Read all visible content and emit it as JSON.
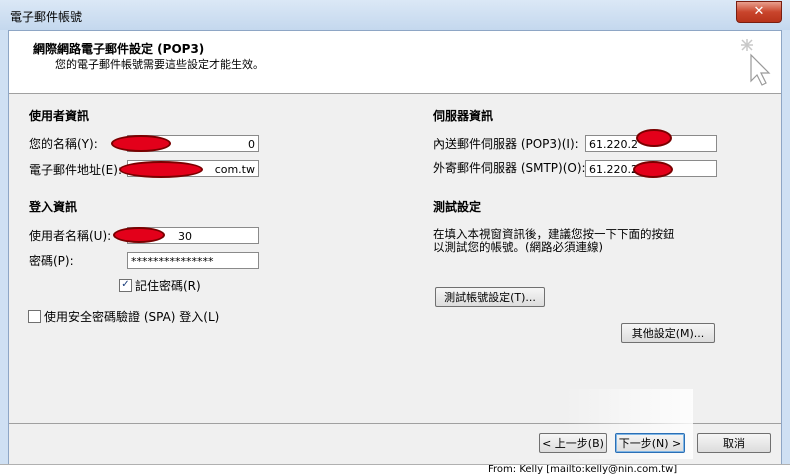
{
  "window": {
    "title": "電子郵件帳號",
    "close_label": "✕"
  },
  "header": {
    "title": "網際網路電子郵件設定 (POP3)",
    "subtitle": "您的電子郵件帳號需要這些設定才能生效。"
  },
  "user_info": {
    "section": "使用者資訊",
    "name_label": "您的名稱(Y):",
    "name_value": "0",
    "email_label": "電子郵件地址(E):",
    "email_value": "com.tw"
  },
  "server_info": {
    "section": "伺服器資訊",
    "incoming_label": "內送郵件伺服器 (POP3)(I):",
    "incoming_value": "61.220.2",
    "outgoing_label": "外寄郵件伺服器 (SMTP)(O):",
    "outgoing_value": "61.220.2"
  },
  "login_info": {
    "section": "登入資訊",
    "username_label": "使用者名稱(U):",
    "username_value": "30",
    "password_label": "密碼(P):",
    "password_value": "***************",
    "remember_label": "記住密碼(R)",
    "remember_checked": "✓",
    "spa_label": "使用安全密碼驗證 (SPA) 登入(L)"
  },
  "test_settings": {
    "section": "測試設定",
    "description_line1": "在填入本視窗資訊後，建議您按一下下面的按鈕",
    "description_line2": "以測試您的帳號。(網路必須連線)",
    "test_button": "測試帳號設定(T)..."
  },
  "buttons": {
    "more_settings": "其他設定(M)...",
    "back": "< 上一步(B)",
    "next": "下一步(N) >",
    "cancel": "取消"
  },
  "background": {
    "text": "From: Kelly [mailto:kelly@nin.com.tw]"
  }
}
